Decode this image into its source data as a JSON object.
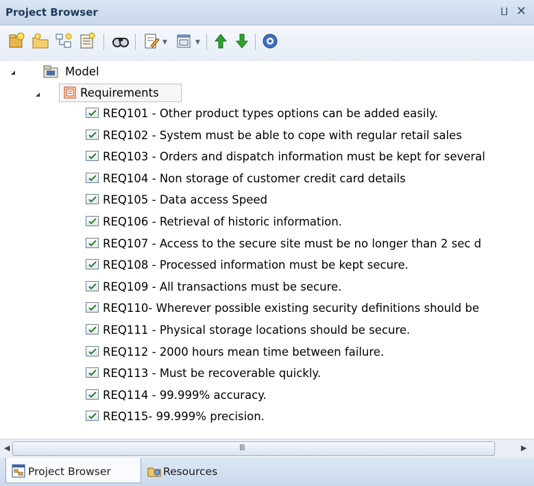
{
  "window": {
    "title": "Project Browser",
    "pin_glyph": "⨿",
    "close_glyph": "✕"
  },
  "toolbar": {
    "buttons": [
      {
        "icon": "new-package-icon"
      },
      {
        "icon": "new-folder-icon"
      },
      {
        "icon": "new-diagram-icon"
      },
      {
        "icon": "new-element-icon"
      },
      {
        "icon": "find-icon"
      },
      {
        "icon": "edit-properties-icon"
      },
      {
        "icon": "view-options-icon"
      },
      {
        "icon": "move-up-icon"
      },
      {
        "icon": "move-down-icon"
      },
      {
        "icon": "help-icon"
      }
    ]
  },
  "tree": {
    "root": {
      "label": "Model",
      "expanded": true
    },
    "package": {
      "label": "Requirements",
      "expanded": true
    },
    "requirements": [
      "REQ101 - Other product types options can be added easily.",
      "REQ102 - System must be able to cope with regular retail sales",
      "REQ103 - Orders and dispatch information must be kept for several",
      "REQ104 - Non storage of customer credit card details",
      "REQ105 -  Data access Speed",
      "REQ106 - Retrieval of historic information.",
      "REQ107 - Access to the secure site must be no longer than 2 sec d",
      "REQ108 - Processed information must be kept secure.",
      "REQ109 - All transactions must be secure.",
      "REQ110- Wherever possible existing security definitions should be",
      "REQ111 - Physical storage locations should be secure.",
      "REQ112 - 2000 hours mean time between failure.",
      "REQ113 - Must be recoverable quickly.",
      "REQ114 - 99.999% accuracy.",
      "REQ115- 99.999% precision."
    ]
  },
  "scrollbar": {
    "left_arrow": "◀",
    "right_arrow": "▶",
    "grip": "III"
  },
  "tabs": [
    {
      "label": "Project Browser",
      "active": true
    },
    {
      "label": "Resources",
      "active": false
    }
  ]
}
